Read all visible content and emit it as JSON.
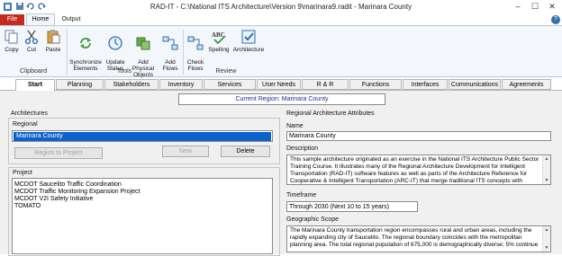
{
  "window": {
    "title": "RAD-IT - C:\\National ITS Architecture\\Version 9\\marinara9.radit  -  Marinara County",
    "minimize": "–",
    "maximize": "☐",
    "close": "✕",
    "help": "?"
  },
  "ribbon_tabs": {
    "file": "File",
    "home": "Home",
    "output": "Output"
  },
  "ribbon": {
    "clipboard": {
      "label": "Clipboard",
      "copy": "Copy",
      "cut": "Cut",
      "paste": "Paste"
    },
    "tools": {
      "label": "Tools",
      "synchronize": "Synchronize\nElements",
      "update_status": "Update\nStatus",
      "add_physical": "Add Physical\nObjects",
      "add_flows": "Add\nFlows"
    },
    "review": {
      "label": "Review",
      "check_flows": "Check\nFlows",
      "spelling": "Spelling",
      "architecture": "Architecture"
    }
  },
  "main_tabs": [
    "Start",
    "Planning",
    "Stakeholders",
    "Inventory",
    "Services",
    "User Needs",
    "R & R",
    "Functions",
    "Interfaces",
    "Communications",
    "Agreements"
  ],
  "current_region": "Current Region: Marinara County",
  "left": {
    "architectures_label": "Architectures",
    "regional_label": "Regional",
    "regional_selected": "Marinara County",
    "region_to_project": "Region to Project",
    "new": "New",
    "delete": "Delete",
    "project_label": "Project",
    "projects": [
      "MCDOT Saucelito Traffic Coordination",
      "MCDOT Traffic Monitoring Expansion Project",
      "MCDOT V2I Safety Initiative",
      "TOMATO"
    ]
  },
  "right": {
    "attributes_label": "Regional Architecture Attributes",
    "name_label": "Name",
    "name_value": "Marinara County",
    "description_label": "Description",
    "description_value": "This sample architecture originated as an exercise in the National ITS Architecture Public Sector Training Course.  It illustrates many of the Regional Architecture Development for Intelligent Transportation (RAD-IT) software features as well as parts of the Architecture Reference for Cooperative & Intelligent Transportation (ARC-IT) that merge traditional ITS concepts with",
    "timeframe_label": "Timeframe",
    "timeframe_value": "Through 2030 (Next 10 to 15 years)",
    "scope_label": "Geographic Scope",
    "scope_value": "The Marinara County transportation region encompasses rural and urban areas, including the rapidly expanding city of Saucelito. The regional boundary coincides with the metropolitan planning area.  The total regional population of 675,000 is demographically diverse; 5% continue"
  }
}
